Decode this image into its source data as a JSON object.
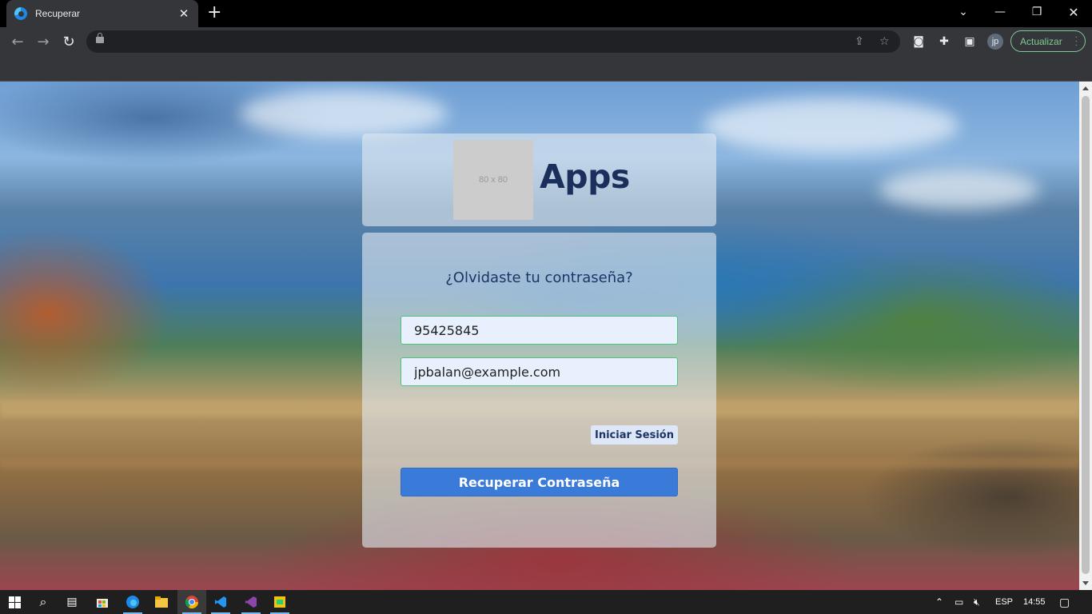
{
  "browser": {
    "tab_title": "Recuperar",
    "update_label": "Actualizar",
    "profile_initials": "jp"
  },
  "page": {
    "logo_placeholder": "80 x 80",
    "brand": "Apps",
    "form": {
      "title": "¿Olvidaste tu contraseña?",
      "phone_value": "95425845",
      "email_value": "jpbalan@example.com",
      "login_link": "Iniciar Sesión",
      "submit_label": "Recuperar Contraseña"
    }
  },
  "taskbar": {
    "language": "ESP",
    "time": "14:55"
  }
}
